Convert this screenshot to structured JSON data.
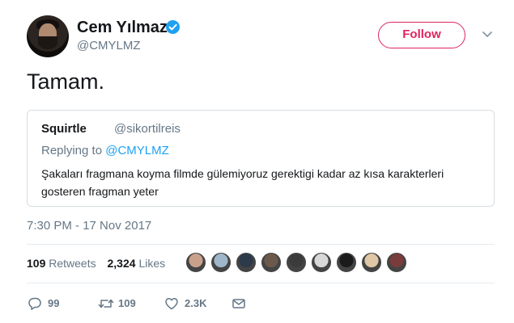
{
  "author": {
    "name": "Cem Yılmaz",
    "handle": "@CMYLMZ"
  },
  "follow_label": "Follow",
  "tweet_text": "Tamam.",
  "quoted": {
    "name": "Squirtle",
    "handle": "@sikortilreis",
    "replying_prefix": "Replying to ",
    "replying_handle": "@CMYLMZ",
    "text": "Şakaları fragmana koyma filmde gülemiyoruz gerektigi kadar az kısa karakterleri gosteren fragman yeter"
  },
  "timestamp": "7:30 PM - 17 Nov 2017",
  "stats": {
    "retweets_count": "109",
    "retweets_label": "Retweets",
    "likes_count": "2,324",
    "likes_label": "Likes"
  },
  "likers_colors": [
    "#c9a08a",
    "#9fb6c9",
    "#2c3a4a",
    "#6b5a4c",
    "#3b3b3b",
    "#d8d8d8",
    "#1b1b1b",
    "#e0c7a6",
    "#7a3b3b"
  ],
  "actions": {
    "replies": "99",
    "retweets": "109",
    "likes": "2.3K"
  },
  "colors": {
    "accent": "#1da1f2",
    "follow": "#e0245e",
    "muted": "#657786"
  }
}
